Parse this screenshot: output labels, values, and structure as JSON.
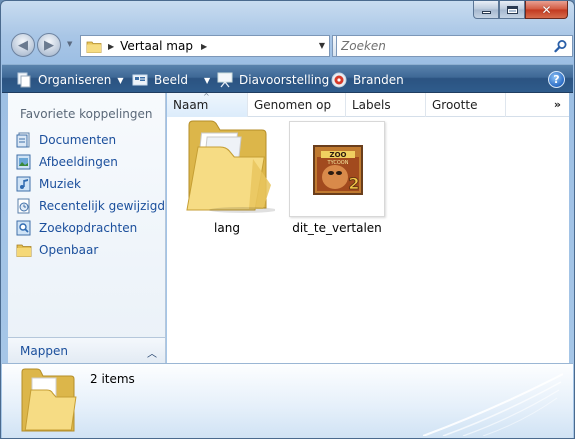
{
  "window": {
    "caption_buttons": {
      "minimize": "minimize",
      "maximize": "maximize",
      "close": "close"
    }
  },
  "address_bar": {
    "path": "Vertaal map",
    "search_placeholder": "Zoeken"
  },
  "command_bar": {
    "items": [
      {
        "label": "Organiseren",
        "icon": "organize-icon",
        "has_dropdown": true
      },
      {
        "label": "Beeld",
        "icon": "views-icon",
        "has_dropdown": true
      },
      {
        "label": "Diavoorstelling",
        "icon": "slideshow-icon",
        "has_dropdown": false
      },
      {
        "label": "Branden",
        "icon": "burn-icon",
        "has_dropdown": false
      }
    ],
    "help": "?"
  },
  "nav_pane": {
    "title": "Favoriete koppelingen",
    "items": [
      {
        "label": "Documenten",
        "icon": "documents-icon"
      },
      {
        "label": "Afbeeldingen",
        "icon": "pictures-icon"
      },
      {
        "label": "Muziek",
        "icon": "music-icon"
      },
      {
        "label": "Recentelijk gewijzigd",
        "icon": "recent-icon"
      },
      {
        "label": "Zoekopdrachten",
        "icon": "searches-icon"
      },
      {
        "label": "Openbaar",
        "icon": "public-folder-icon"
      }
    ],
    "folders_label": "Mappen"
  },
  "columns": [
    "Naam",
    "Genomen op",
    "Labels",
    "Grootte"
  ],
  "columns_more": "»",
  "files": [
    {
      "name": "lang",
      "type": "folder"
    },
    {
      "name": "dit_te_vertalen",
      "type": "image"
    }
  ],
  "details": {
    "count": "2 items"
  },
  "colors": {
    "command_bar": "#2f5c8c",
    "link_text": "#1b4f9c",
    "folder": "#f2d57a"
  }
}
